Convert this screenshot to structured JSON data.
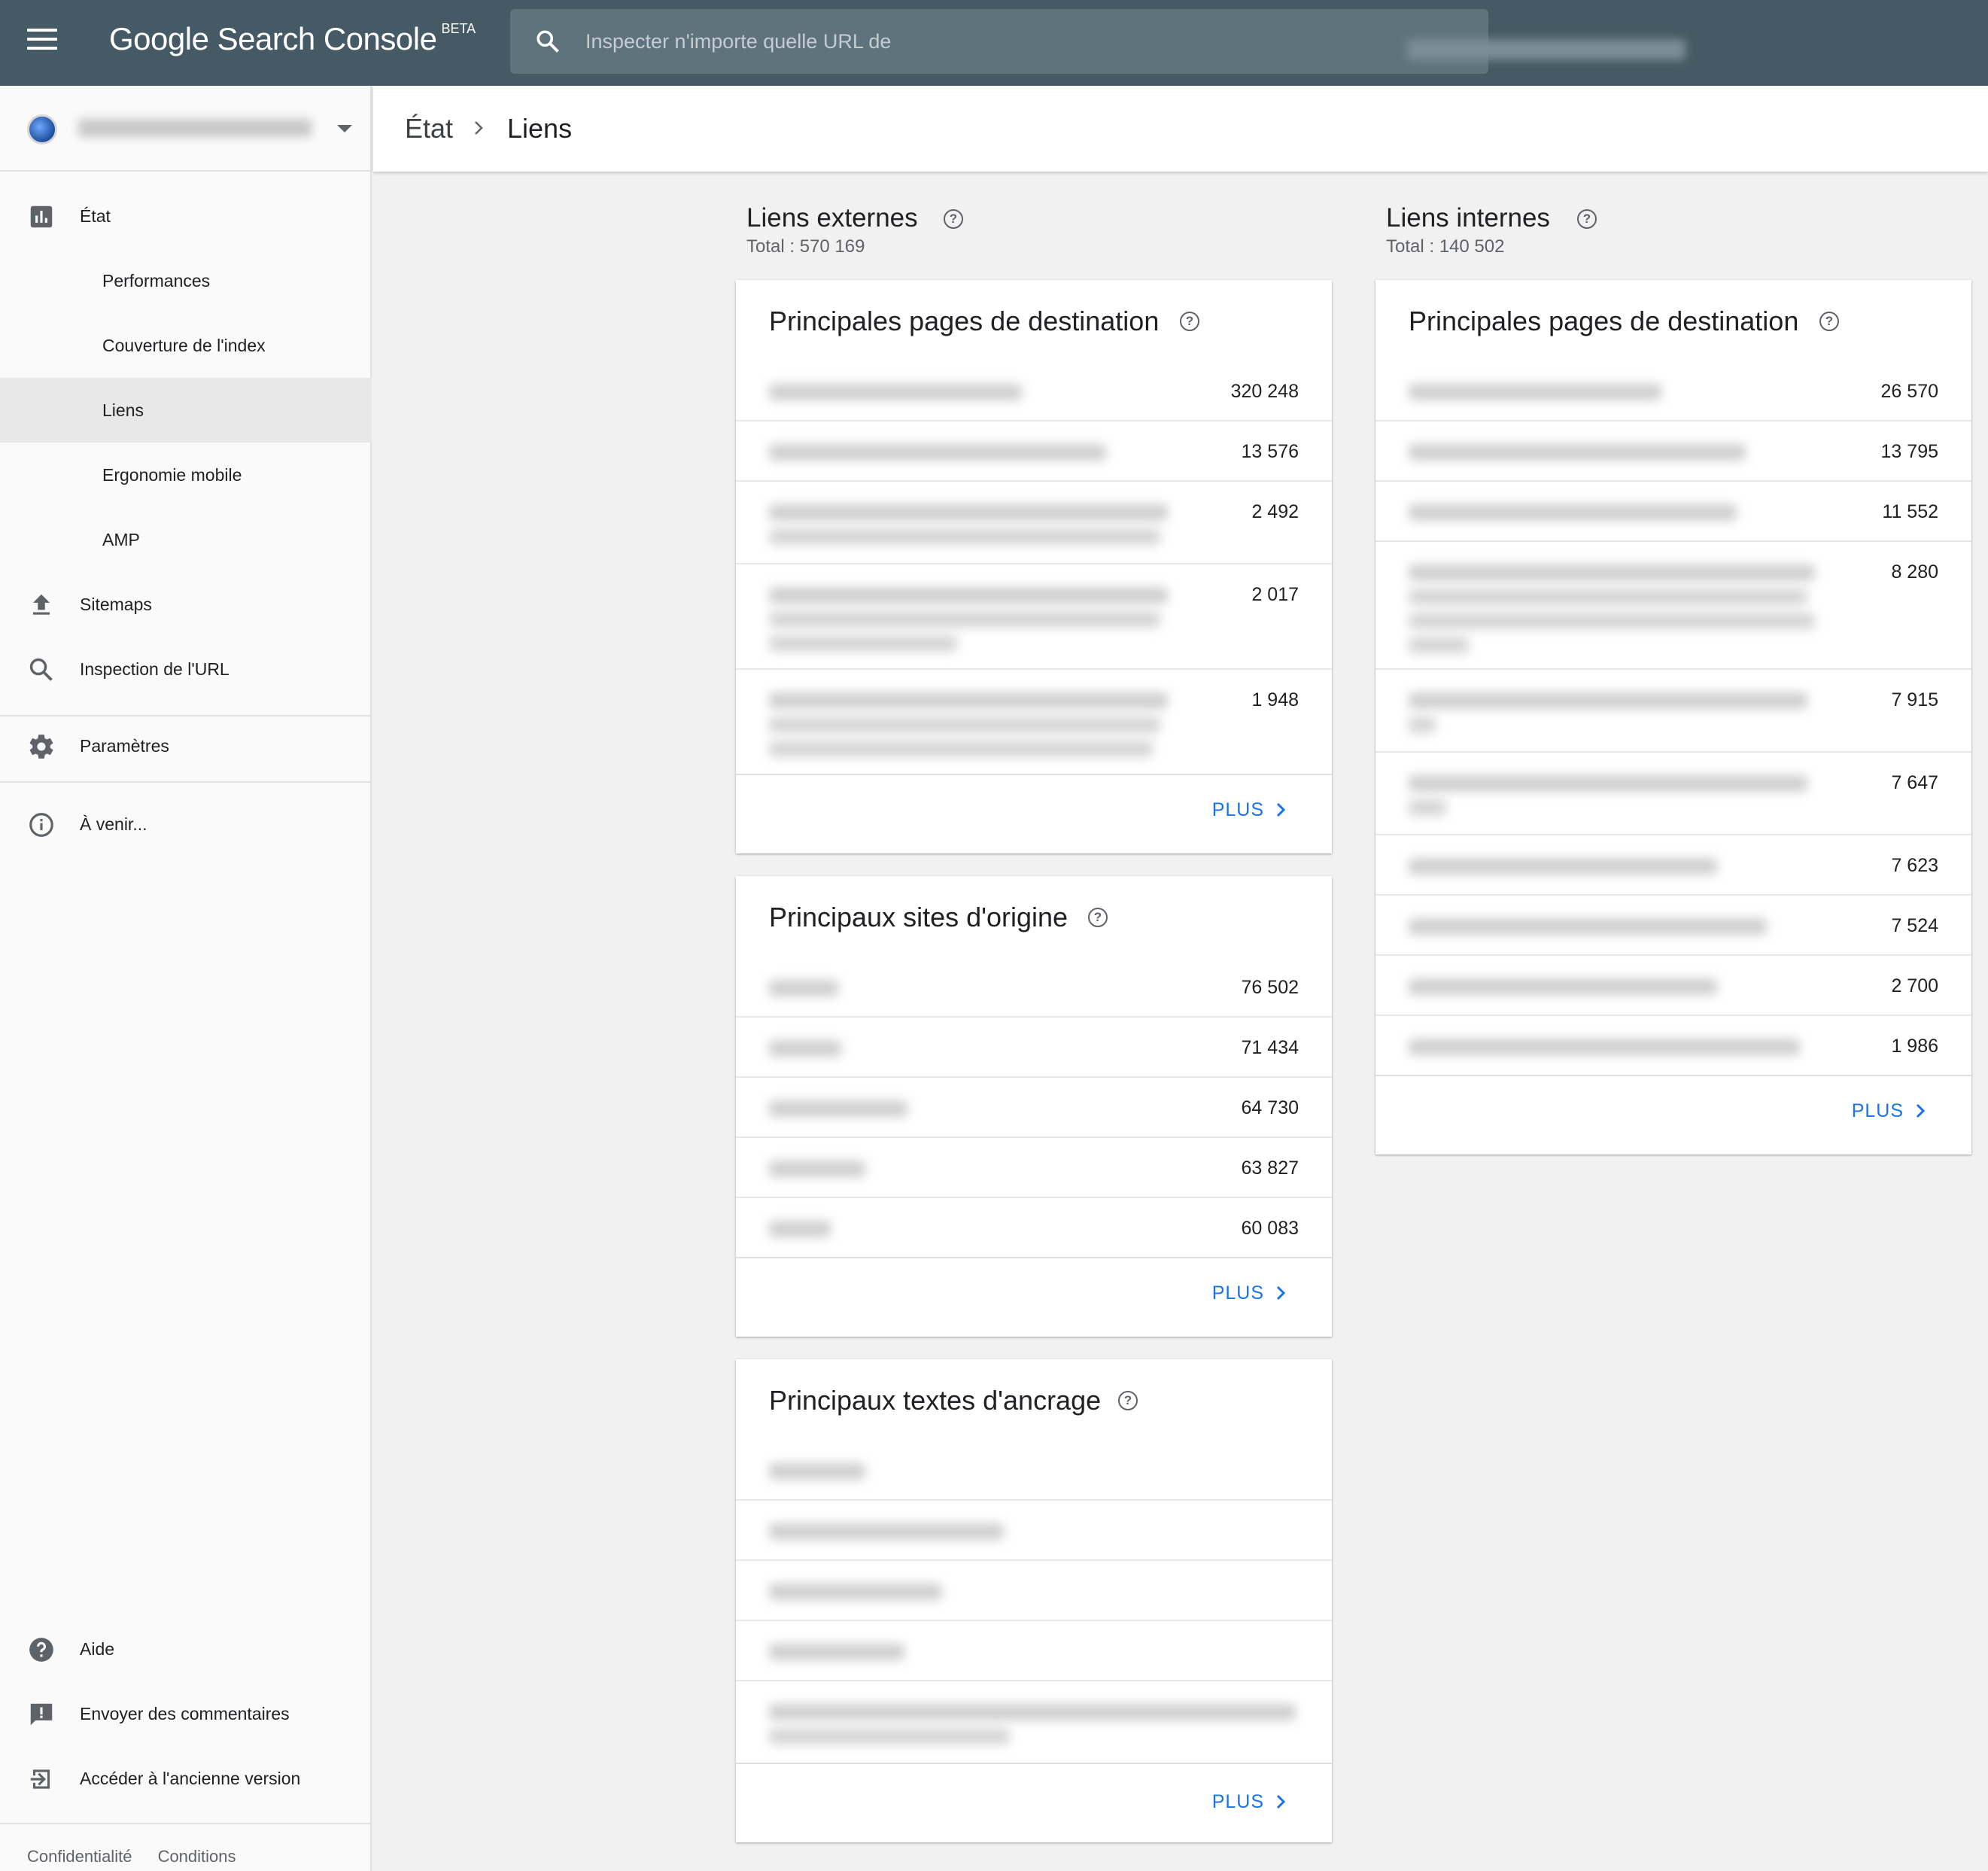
{
  "header": {
    "menu_icon": "menu-icon",
    "brand": "Google Search Console",
    "brand_badge": "BETA",
    "search_placeholder": "Inspecter n'importe quelle URL de"
  },
  "sidebar": {
    "items": [
      {
        "label": "État",
        "icon": "bar-chart-icon"
      },
      {
        "label": "Performances"
      },
      {
        "label": "Couverture de l'index"
      },
      {
        "label": "Liens",
        "active": true
      },
      {
        "label": "Ergonomie mobile"
      },
      {
        "label": "AMP"
      },
      {
        "label": "Sitemaps",
        "icon": "upload-icon"
      },
      {
        "label": "Inspection de l'URL",
        "icon": "search-icon"
      },
      {
        "label": "Paramètres",
        "icon": "gear-icon"
      },
      {
        "label": "À venir...",
        "icon": "info-icon"
      },
      {
        "label": "Aide",
        "icon": "help-icon"
      },
      {
        "label": "Envoyer des commentaires",
        "icon": "feedback-icon"
      },
      {
        "label": "Accéder à l'ancienne version",
        "icon": "exit-icon"
      }
    ],
    "footer": {
      "privacy": "Confidentialité",
      "terms": "Conditions"
    }
  },
  "breadcrumb": {
    "root": "État",
    "current": "Liens"
  },
  "external": {
    "title": "Liens externes",
    "total": "Total : 570 169",
    "top_pages": {
      "title": "Principales pages de destination",
      "values": [
        "320 248",
        "13 576",
        "2 492",
        "2 017",
        "1 948"
      ],
      "more": "PLUS"
    },
    "top_sites": {
      "title": "Principaux sites d'origine",
      "values": [
        "76 502",
        "71 434",
        "64 730",
        "63 827",
        "60 083"
      ],
      "more": "PLUS"
    },
    "top_anchors": {
      "title": "Principaux textes d'ancrage",
      "more": "PLUS"
    }
  },
  "internal": {
    "title": "Liens internes",
    "total": "Total : 140 502",
    "top_pages": {
      "title": "Principales pages de destination",
      "values": [
        "26 570",
        "13 795",
        "11 552",
        "8 280",
        "7 915",
        "7 647",
        "7 623",
        "7 524",
        "2 700",
        "1 986"
      ],
      "more": "PLUS"
    }
  },
  "colors": {
    "topbar": "#455a64",
    "accent": "#1a73e8",
    "active_nav": "#e8e8e8"
  }
}
